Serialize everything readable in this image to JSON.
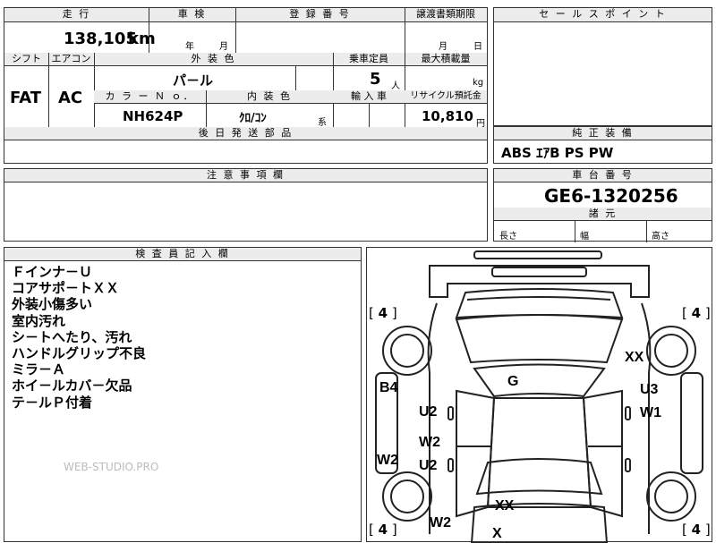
{
  "top": {
    "mileage_label": "走 行",
    "mileage_value": "138,105",
    "mileage_unit": "km",
    "inspection_label": "車 検",
    "inspection_year": "年",
    "inspection_month": "月",
    "reg_label": "登 録 番 号",
    "transfer_label": "譲渡書類期限",
    "transfer_month": "月",
    "transfer_day": "日"
  },
  "spec": {
    "shift_label": "シフト",
    "shift_value": "FAT",
    "ac_label": "エアコン",
    "ac_value": "AC",
    "ext_color_label": "外 装 色",
    "ext_color_value": "パ－ル",
    "capacity_label": "乗車定員",
    "capacity_value": "5",
    "capacity_unit": "人",
    "load_label": "最大積載量",
    "load_unit": "kg",
    "color_no_label": "カ ラ ー Ｎ ｏ．",
    "color_no_value": "NH624P",
    "int_color_label": "内 装 色",
    "int_color_value": "ｸﾛ/ｺﾝ",
    "int_color_suffix": "系",
    "import_label": "輸 入 車",
    "recycle_label": "リサイクル預託金",
    "recycle_value": "10,810",
    "recycle_unit": "円",
    "later_parts_label": "後 日 発 送 部 品"
  },
  "sales_point": {
    "label": "セ ー ル ス ポ イ ン ト"
  },
  "equipment": {
    "label": "純 正 装 備",
    "value": "ABS ｴｱB PS PW"
  },
  "caution": {
    "label": "注 意 事 項 欄"
  },
  "chassis": {
    "label": "車 台 番 号",
    "value": "GE6-1320256"
  },
  "dims": {
    "label": "諸 元",
    "length": "長さ",
    "width": "幅",
    "height": "高さ"
  },
  "inspector": {
    "label": "検 査 員 記 入 欄",
    "notes": [
      "Ｆインナ－Ｕ",
      "コアサポ－トＸＸ",
      "外装小傷多い",
      "室内汚れ",
      "シ－トへたり、汚れ",
      "ハンドルグリップ不良",
      "ミラ－Ａ",
      "ホイ－ルカバ－欠品",
      "テ－ルＰ付着"
    ],
    "watermark": "WEB-STUDIO.PRO"
  },
  "diagram": {
    "tire_fl": "4",
    "tire_fr": "4",
    "tire_rl": "4",
    "tire_rr": "4",
    "bracket_open": "[",
    "bracket_close": "]",
    "marks": {
      "roof": "G",
      "front_right_fender": "XX",
      "front_left_pillar": "B4",
      "front_left_door": "U2",
      "front_right_door_1": "U3",
      "front_right_door_2": "W1",
      "rear_left_door_1": "W2",
      "rear_left_door_2": "U2",
      "left_sill": "W2",
      "trunk": "XX",
      "rear_left": "W2",
      "rear_center": "X"
    }
  }
}
